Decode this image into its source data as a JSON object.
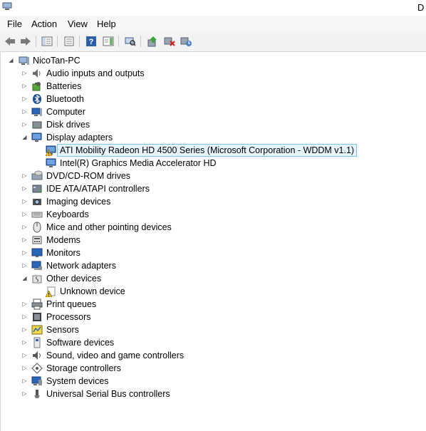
{
  "window": {
    "title_fragment": "D"
  },
  "menu": {
    "file": "File",
    "action": "Action",
    "view": "View",
    "help": "Help"
  },
  "toolbar": {
    "buttons": [
      "back-icon",
      "forward-icon",
      "properties-icon",
      "console-tree-icon",
      "help-icon",
      "action-pane-icon",
      "scan-hardware-icon",
      "update-driver-icon",
      "disable-device-icon",
      "uninstall-icon"
    ]
  },
  "tree": {
    "root": "NicoTan-PC",
    "categories": [
      {
        "label": "Audio inputs and outputs"
      },
      {
        "label": "Batteries"
      },
      {
        "label": "Bluetooth"
      },
      {
        "label": "Computer"
      },
      {
        "label": "Disk drives"
      },
      {
        "label": "Display adapters",
        "expanded": true,
        "children": [
          {
            "label": "ATI Mobility Radeon HD 4500 Series (Microsoft Corporation - WDDM v1.1)",
            "warning": true,
            "selected": true
          },
          {
            "label": "Intel(R) Graphics Media Accelerator HD"
          }
        ]
      },
      {
        "label": "DVD/CD-ROM drives"
      },
      {
        "label": "IDE ATA/ATAPI controllers"
      },
      {
        "label": "Imaging devices"
      },
      {
        "label": "Keyboards"
      },
      {
        "label": "Mice and other pointing devices"
      },
      {
        "label": "Modems"
      },
      {
        "label": "Monitors"
      },
      {
        "label": "Network adapters"
      },
      {
        "label": "Other devices",
        "expanded": true,
        "children": [
          {
            "label": "Unknown device",
            "warning": true
          }
        ]
      },
      {
        "label": "Print queues"
      },
      {
        "label": "Processors"
      },
      {
        "label": "Sensors"
      },
      {
        "label": "Software devices"
      },
      {
        "label": "Sound, video and game controllers"
      },
      {
        "label": "Storage controllers"
      },
      {
        "label": "System devices"
      },
      {
        "label": "Universal Serial Bus controllers"
      }
    ]
  },
  "colors": {
    "selection_bg": "#e5f3fb",
    "selection_border": "#7ac4ed",
    "warning": "#f2c200",
    "device_blue": "#2a66b8"
  }
}
